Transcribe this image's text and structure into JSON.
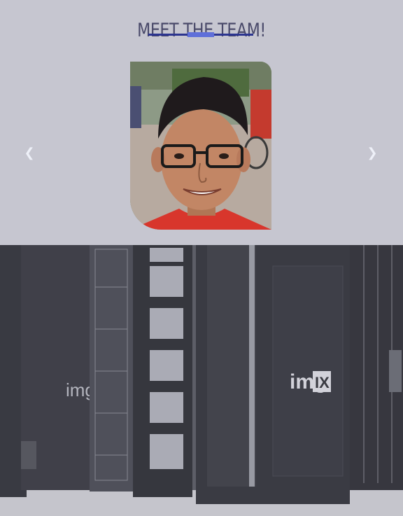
{
  "team": {
    "title": "MEET THE TEAM!",
    "prev_arrow": "❮",
    "next_arrow": "❯"
  },
  "banner": {
    "brand_left": "imgix",
    "brand_right_prefix": "img",
    "brand_right_box": "IX"
  },
  "colors": {
    "background": "#c6c6d0",
    "title": "#4a4a6a",
    "underline": "#2c3590",
    "underline_accent": "#5f6fd9"
  }
}
